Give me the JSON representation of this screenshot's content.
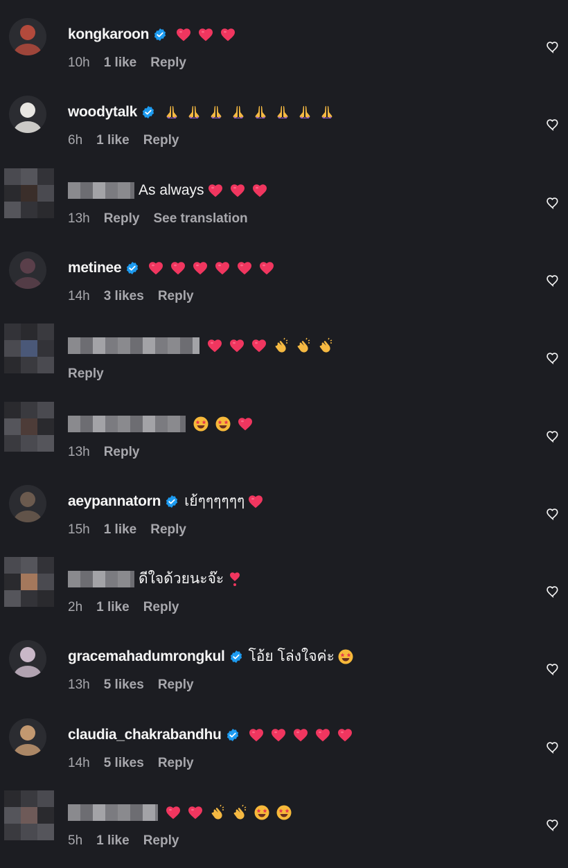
{
  "comments": [
    {
      "username": "kongkaroon",
      "verified": true,
      "masked": false,
      "text": "",
      "emojis": [
        "heart",
        "heart",
        "heart"
      ],
      "time": "10h",
      "likes": "1 like",
      "actions": [
        "Reply"
      ],
      "avatar_color": "#b34a3c"
    },
    {
      "username": "woodytalk",
      "verified": true,
      "masked": false,
      "text": "",
      "emojis": [
        "pray",
        "pray",
        "pray",
        "pray",
        "pray",
        "pray",
        "pray",
        "pray"
      ],
      "time": "6h",
      "likes": "1 like",
      "actions": [
        "Reply"
      ],
      "avatar_color": "#e8e6e2"
    },
    {
      "username": "",
      "verified": false,
      "masked": true,
      "text": "As always",
      "emojis": [
        "heart",
        "heart",
        "heart"
      ],
      "time": "13h",
      "likes": "",
      "actions": [
        "Reply",
        "See translation"
      ],
      "avatar_color": "#3a2e2a"
    },
    {
      "username": "metinee",
      "verified": true,
      "masked": false,
      "text": "",
      "emojis": [
        "heart",
        "heart",
        "heart",
        "heart",
        "heart",
        "heart"
      ],
      "time": "14h",
      "likes": "3 likes",
      "actions": [
        "Reply"
      ],
      "avatar_color": "#5a3f4a"
    },
    {
      "username": "",
      "verified": false,
      "masked": true,
      "text": "",
      "emojis": [
        "heart",
        "heart",
        "heart",
        "clap",
        "clap",
        "clap"
      ],
      "time": "",
      "likes": "",
      "actions": [
        "Reply"
      ],
      "avatar_color": "#4a5878"
    },
    {
      "username": "",
      "verified": false,
      "masked": true,
      "text": "",
      "emojis": [
        "star-eyes",
        "star-eyes",
        "heart"
      ],
      "time": "13h",
      "likes": "",
      "actions": [
        "Reply"
      ],
      "avatar_color": "#4d3c38"
    },
    {
      "username": "aeypannatorn",
      "verified": true,
      "masked": false,
      "text": "เย้ๆๆๆๆๆๆ",
      "emojis": [
        "heart"
      ],
      "time": "15h",
      "likes": "1 like",
      "actions": [
        "Reply"
      ],
      "avatar_color": "#6b5a4e"
    },
    {
      "username": "",
      "verified": false,
      "masked": true,
      "text": "ดีใจด้วยนะจ๊ะ",
      "emojis": [
        "heart-ex"
      ],
      "time": "2h",
      "likes": "1 like",
      "actions": [
        "Reply"
      ],
      "avatar_color": "#a4785c"
    },
    {
      "username": "gracemahadumrongkul",
      "verified": true,
      "masked": false,
      "text": "โอ้ย โล่งใจค่ะ",
      "emojis": [
        "star-eyes"
      ],
      "time": "13h",
      "likes": "5 likes",
      "actions": [
        "Reply"
      ],
      "avatar_color": "#c9b8c8"
    },
    {
      "username": "claudia_chakrabandhu",
      "verified": true,
      "masked": false,
      "text": "",
      "emojis": [
        "heart",
        "heart",
        "heart",
        "heart",
        "heart"
      ],
      "time": "14h",
      "likes": "5 likes",
      "actions": [
        "Reply"
      ],
      "avatar_color": "#c29870"
    },
    {
      "username": "",
      "verified": false,
      "masked": true,
      "text": "",
      "emojis": [
        "heart",
        "heart",
        "clap",
        "clap",
        "star-eyes",
        "star-eyes"
      ],
      "time": "5h",
      "likes": "1 like",
      "actions": [
        "Reply"
      ],
      "avatar_color": "#6e5a58"
    }
  ],
  "colors": {
    "heart": "#f0365f",
    "verified": "#1d9bf0",
    "muted": "#a8a8ad",
    "background": "#1c1d22"
  }
}
